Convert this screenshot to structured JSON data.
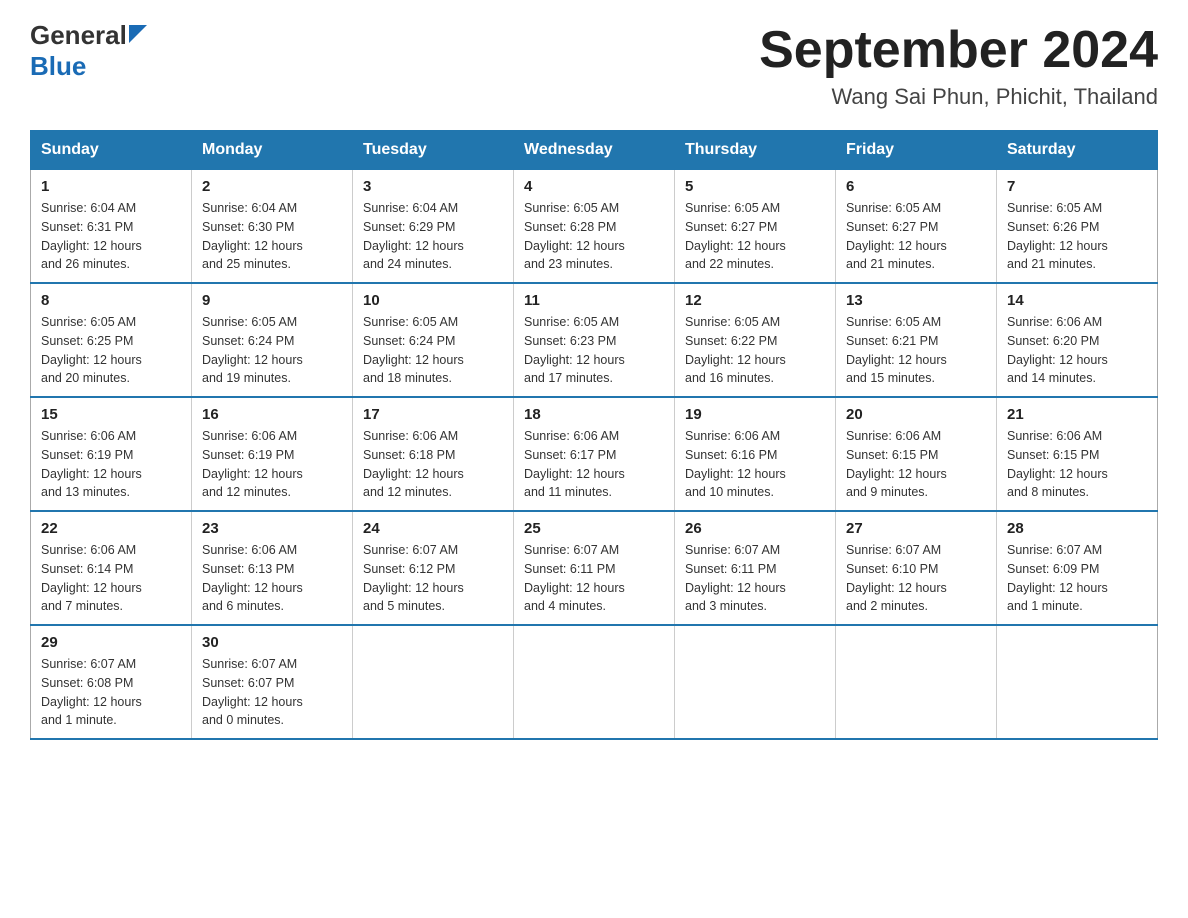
{
  "header": {
    "logo_general": "General",
    "logo_blue": "Blue",
    "title": "September 2024",
    "subtitle": "Wang Sai Phun, Phichit, Thailand"
  },
  "days_of_week": [
    "Sunday",
    "Monday",
    "Tuesday",
    "Wednesday",
    "Thursday",
    "Friday",
    "Saturday"
  ],
  "weeks": [
    [
      {
        "day": "1",
        "sunrise": "6:04 AM",
        "sunset": "6:31 PM",
        "daylight": "12 hours and 26 minutes."
      },
      {
        "day": "2",
        "sunrise": "6:04 AM",
        "sunset": "6:30 PM",
        "daylight": "12 hours and 25 minutes."
      },
      {
        "day": "3",
        "sunrise": "6:04 AM",
        "sunset": "6:29 PM",
        "daylight": "12 hours and 24 minutes."
      },
      {
        "day": "4",
        "sunrise": "6:05 AM",
        "sunset": "6:28 PM",
        "daylight": "12 hours and 23 minutes."
      },
      {
        "day": "5",
        "sunrise": "6:05 AM",
        "sunset": "6:27 PM",
        "daylight": "12 hours and 22 minutes."
      },
      {
        "day": "6",
        "sunrise": "6:05 AM",
        "sunset": "6:27 PM",
        "daylight": "12 hours and 21 minutes."
      },
      {
        "day": "7",
        "sunrise": "6:05 AM",
        "sunset": "6:26 PM",
        "daylight": "12 hours and 21 minutes."
      }
    ],
    [
      {
        "day": "8",
        "sunrise": "6:05 AM",
        "sunset": "6:25 PM",
        "daylight": "12 hours and 20 minutes."
      },
      {
        "day": "9",
        "sunrise": "6:05 AM",
        "sunset": "6:24 PM",
        "daylight": "12 hours and 19 minutes."
      },
      {
        "day": "10",
        "sunrise": "6:05 AM",
        "sunset": "6:24 PM",
        "daylight": "12 hours and 18 minutes."
      },
      {
        "day": "11",
        "sunrise": "6:05 AM",
        "sunset": "6:23 PM",
        "daylight": "12 hours and 17 minutes."
      },
      {
        "day": "12",
        "sunrise": "6:05 AM",
        "sunset": "6:22 PM",
        "daylight": "12 hours and 16 minutes."
      },
      {
        "day": "13",
        "sunrise": "6:05 AM",
        "sunset": "6:21 PM",
        "daylight": "12 hours and 15 minutes."
      },
      {
        "day": "14",
        "sunrise": "6:06 AM",
        "sunset": "6:20 PM",
        "daylight": "12 hours and 14 minutes."
      }
    ],
    [
      {
        "day": "15",
        "sunrise": "6:06 AM",
        "sunset": "6:19 PM",
        "daylight": "12 hours and 13 minutes."
      },
      {
        "day": "16",
        "sunrise": "6:06 AM",
        "sunset": "6:19 PM",
        "daylight": "12 hours and 12 minutes."
      },
      {
        "day": "17",
        "sunrise": "6:06 AM",
        "sunset": "6:18 PM",
        "daylight": "12 hours and 12 minutes."
      },
      {
        "day": "18",
        "sunrise": "6:06 AM",
        "sunset": "6:17 PM",
        "daylight": "12 hours and 11 minutes."
      },
      {
        "day": "19",
        "sunrise": "6:06 AM",
        "sunset": "6:16 PM",
        "daylight": "12 hours and 10 minutes."
      },
      {
        "day": "20",
        "sunrise": "6:06 AM",
        "sunset": "6:15 PM",
        "daylight": "12 hours and 9 minutes."
      },
      {
        "day": "21",
        "sunrise": "6:06 AM",
        "sunset": "6:15 PM",
        "daylight": "12 hours and 8 minutes."
      }
    ],
    [
      {
        "day": "22",
        "sunrise": "6:06 AM",
        "sunset": "6:14 PM",
        "daylight": "12 hours and 7 minutes."
      },
      {
        "day": "23",
        "sunrise": "6:06 AM",
        "sunset": "6:13 PM",
        "daylight": "12 hours and 6 minutes."
      },
      {
        "day": "24",
        "sunrise": "6:07 AM",
        "sunset": "6:12 PM",
        "daylight": "12 hours and 5 minutes."
      },
      {
        "day": "25",
        "sunrise": "6:07 AM",
        "sunset": "6:11 PM",
        "daylight": "12 hours and 4 minutes."
      },
      {
        "day": "26",
        "sunrise": "6:07 AM",
        "sunset": "6:11 PM",
        "daylight": "12 hours and 3 minutes."
      },
      {
        "day": "27",
        "sunrise": "6:07 AM",
        "sunset": "6:10 PM",
        "daylight": "12 hours and 2 minutes."
      },
      {
        "day": "28",
        "sunrise": "6:07 AM",
        "sunset": "6:09 PM",
        "daylight": "12 hours and 1 minute."
      }
    ],
    [
      {
        "day": "29",
        "sunrise": "6:07 AM",
        "sunset": "6:08 PM",
        "daylight": "12 hours and 1 minute."
      },
      {
        "day": "30",
        "sunrise": "6:07 AM",
        "sunset": "6:07 PM",
        "daylight": "12 hours and 0 minutes."
      },
      null,
      null,
      null,
      null,
      null
    ]
  ],
  "labels": {
    "sunrise": "Sunrise:",
    "sunset": "Sunset:",
    "daylight": "Daylight:"
  }
}
